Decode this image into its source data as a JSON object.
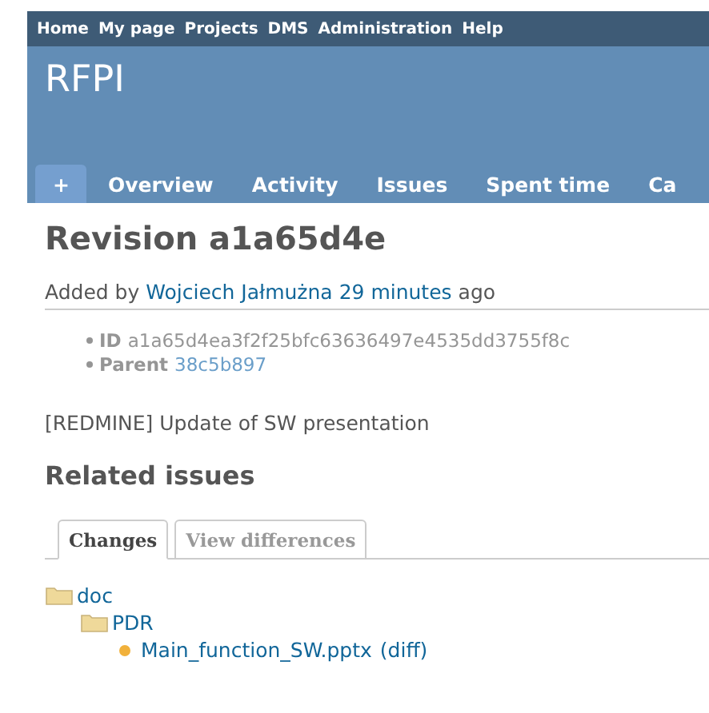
{
  "top_menu": [
    "Home",
    "My page",
    "Projects",
    "DMS",
    "Administration",
    "Help"
  ],
  "project_title": "RFPI",
  "main_tabs": [
    {
      "label": "+",
      "selected": true
    },
    {
      "label": "Overview",
      "selected": false
    },
    {
      "label": "Activity",
      "selected": false
    },
    {
      "label": "Issues",
      "selected": false
    },
    {
      "label": "Spent time",
      "selected": false
    },
    {
      "label": "Ca",
      "selected": false
    }
  ],
  "heading": "Revision a1a65d4e",
  "added_by": {
    "prefix": "Added by",
    "author": "Wojciech Jałmużna",
    "time": "29 minutes",
    "suffix": "ago"
  },
  "details": [
    {
      "label": "ID",
      "value": "a1a65d4ea3f2f25bfc63636497e4535dd3755f8c",
      "link": false
    },
    {
      "label": "Parent",
      "value": "38c5b897",
      "link": true
    }
  ],
  "message": "[REDMINE] Update of SW presentation",
  "related_heading": "Related issues",
  "change_tabs": [
    {
      "label": "Changes",
      "selected": true
    },
    {
      "label": "View differences",
      "selected": false
    }
  ],
  "tree": [
    {
      "kind": "folder",
      "name": "doc",
      "children": [
        {
          "kind": "folder",
          "name": "PDR",
          "children": [
            {
              "kind": "file",
              "name": "Main_function_SW.pptx",
              "action": "(diff)"
            }
          ]
        }
      ]
    }
  ]
}
